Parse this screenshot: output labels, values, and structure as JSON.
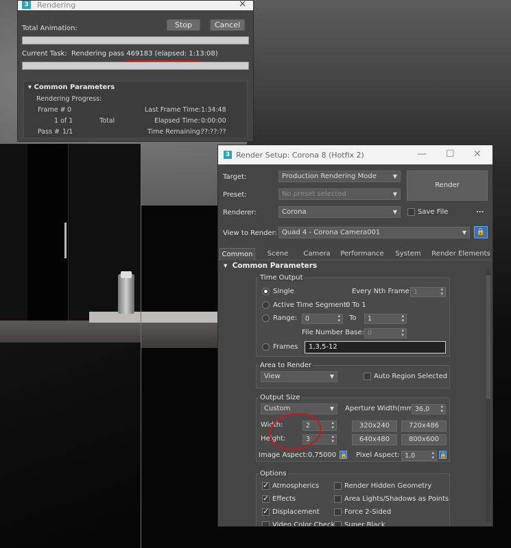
{
  "rendering_window": {
    "title": "Rendering",
    "stop_label": "Stop",
    "cancel_label": "Cancel",
    "total_animation_label": "Total Animation:",
    "current_task_label": "Current Task:",
    "current_task_value": "Rendering pass 469183 (elapsed: 1:13:08)",
    "total_animation_progress": 0.0,
    "current_task_progress": 0.0,
    "panel_title": "Common Parameters",
    "rendering_progress_label": "Rendering Progress:",
    "frame_label": "Frame #",
    "frame_value": "0",
    "frames_of": "1 of 1",
    "total_label": "Total",
    "pass_label": "Pass #",
    "pass_value": "1/1",
    "last_frame_time_label": "Last Frame Time:",
    "last_frame_time_value": "1:34:48",
    "elapsed_time_label": "Elapsed Time:",
    "elapsed_time_value": "0:00:00",
    "time_remaining_label": "Time Remaining:",
    "time_remaining_value": "??:??:??"
  },
  "render_setup": {
    "title": "Render Setup: Corona 8 (Hotfix 2)",
    "target_label": "Target:",
    "target_value": "Production Rendering Mode",
    "preset_label": "Preset:",
    "preset_value": "No preset selected",
    "renderer_label": "Renderer:",
    "renderer_value": "Corona",
    "save_file_label": "Save File",
    "more_label": "...",
    "render_label": "Render",
    "view_label": "View to Render:",
    "view_value": "Quad 4 - Corona Camera001",
    "tabs": [
      "Common",
      "Scene",
      "Camera",
      "Performance",
      "System",
      "Render Elements"
    ],
    "rollout_title": "Common Parameters",
    "time_output": {
      "title": "Time Output",
      "single": "Single",
      "every_nth_label": "Every Nth Frame:",
      "every_nth_value": "1",
      "active_segment": "Active Time Segment:",
      "active_segment_value": "0 To 1",
      "range": "Range:",
      "range_from": "0",
      "range_to_label": "To",
      "range_to": "1",
      "file_number_base_label": "File Number Base:",
      "file_number_base_value": "0",
      "frames": "Frames",
      "frames_value": "1,3,5-12"
    },
    "area_to_render": {
      "title": "Area to Render",
      "value": "View",
      "auto_region": "Auto Region Selected"
    },
    "output_size": {
      "title": "Output Size",
      "preset": "Custom",
      "aperture_label": "Aperture Width(mm):",
      "aperture_value": "36,0",
      "width_label": "Width:",
      "width_value": "2",
      "height_label": "Height:",
      "height_value": "3",
      "presets": [
        "320x240",
        "720x486",
        "640x480",
        "800x600"
      ],
      "image_aspect": "Image Aspect:0,75000",
      "pixel_aspect_label": "Pixel Aspect:",
      "pixel_aspect_value": "1,0"
    },
    "options": {
      "title": "Options",
      "atmospherics": "Atmospherics",
      "effects": "Effects",
      "displacement": "Displacement",
      "video_color_check": "Video Color Check",
      "render_hidden": "Render Hidden Geometry",
      "area_lights": "Area Lights/Shadows as Points",
      "force_2sided": "Force 2-Sided",
      "super_black": "Super Black"
    }
  }
}
